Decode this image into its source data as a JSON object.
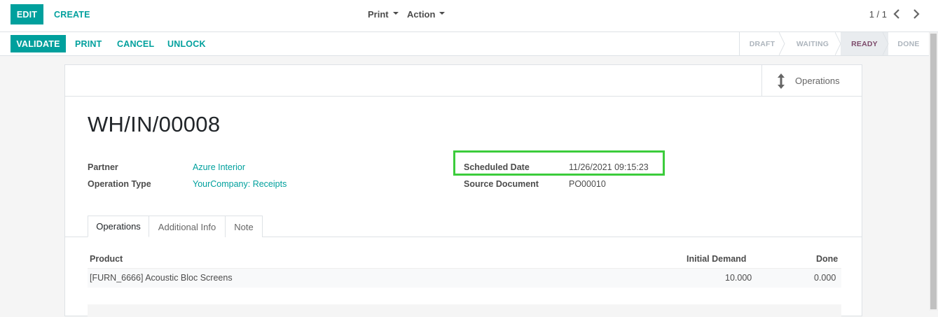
{
  "control_panel": {
    "edit_label": "EDIT",
    "create_label": "CREATE",
    "print_label": "Print",
    "action_label": "Action",
    "pager": "1 / 1"
  },
  "statusbar": {
    "buttons": [
      "VALIDATE",
      "PRINT",
      "CANCEL",
      "UNLOCK"
    ],
    "stages": [
      {
        "label": "DRAFT",
        "active": false
      },
      {
        "label": "WAITING",
        "active": false
      },
      {
        "label": "READY",
        "active": true
      },
      {
        "label": "DONE",
        "active": false
      }
    ]
  },
  "smart_button": {
    "label": "Operations"
  },
  "record": {
    "name": "WH/IN/00008",
    "partner_label": "Partner",
    "partner_value": "Azure Interior",
    "operation_type_label": "Operation Type",
    "operation_type_value": "YourCompany: Receipts",
    "scheduled_date_label": "Scheduled Date",
    "scheduled_date_value": "11/26/2021 09:15:23",
    "source_document_label": "Source Document",
    "source_document_value": "PO00010"
  },
  "tabs": [
    {
      "label": "Operations",
      "active": true
    },
    {
      "label": "Additional Info",
      "active": false
    },
    {
      "label": "Note",
      "active": false
    }
  ],
  "table": {
    "columns": [
      "Product",
      "Initial Demand",
      "Done"
    ],
    "rows": [
      {
        "product": "[FURN_6666] Acoustic Bloc Screens",
        "initial_demand": "10.000",
        "done": "0.000"
      }
    ]
  },
  "colors": {
    "primary": "#00A09D",
    "active_stage": "#7c4a6a",
    "highlight": "#3ccc3c"
  }
}
